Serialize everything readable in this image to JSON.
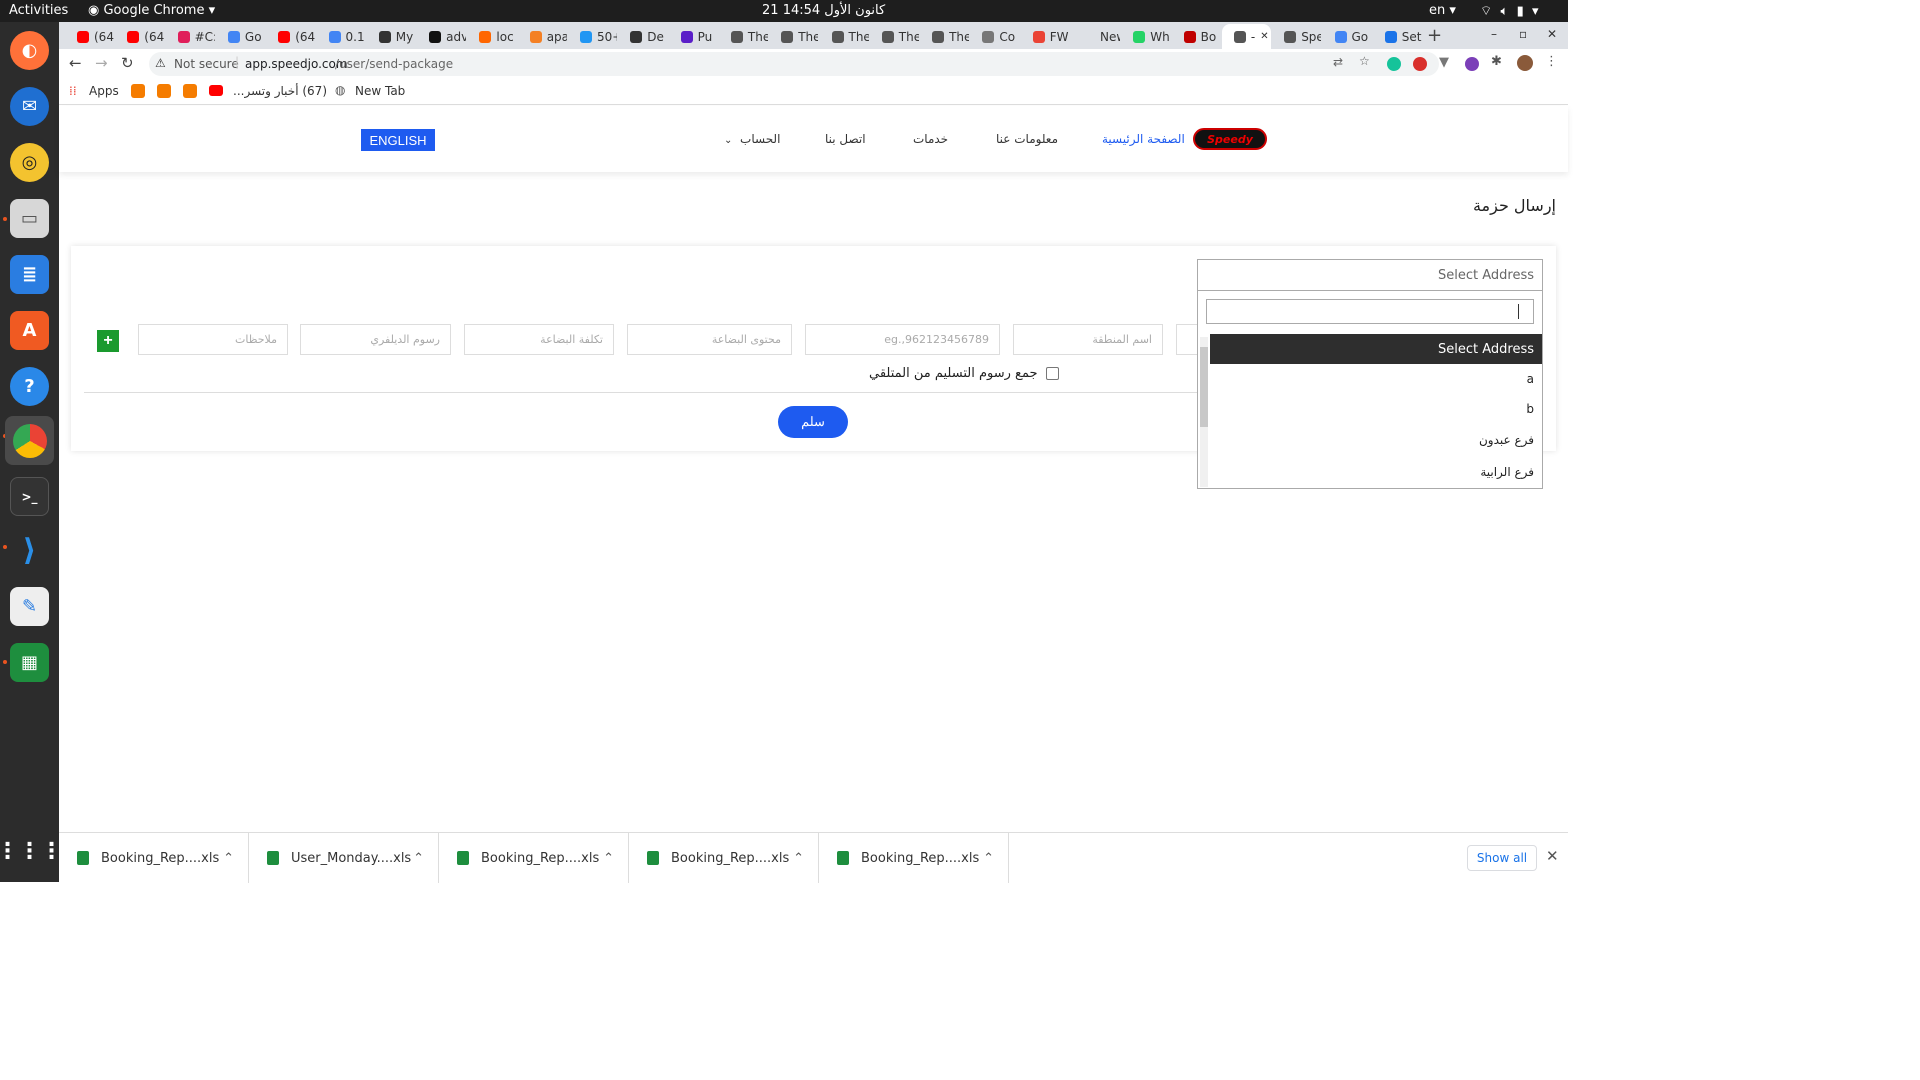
{
  "system_bar": {
    "activities": "Activities",
    "app_name": "Google Chrome",
    "datetime": "21 كانون الأول 14:54",
    "lang": "en"
  },
  "dock": {
    "apps": [
      "firefox-icon",
      "thunderbird-icon",
      "rhythmbox-icon",
      "files-icon",
      "writer-icon",
      "software-icon",
      "help-icon",
      "chrome-icon",
      "terminal-icon",
      "vscode-icon",
      "text-editor-icon",
      "calc-icon"
    ],
    "grid": "show-apps-icon"
  },
  "tabs": [
    {
      "label": "(64",
      "color": "#ff0000"
    },
    {
      "label": "(64",
      "color": "#ff0000"
    },
    {
      "label": "#C:",
      "color": "#e01e5a"
    },
    {
      "label": "Go",
      "color": "#4285f4"
    },
    {
      "label": "(64",
      "color": "#ff0000"
    },
    {
      "label": "0.1",
      "color": "#4285f4"
    },
    {
      "label": "My",
      "color": "#333333"
    },
    {
      "label": "adv",
      "color": "#111111"
    },
    {
      "label": "loc",
      "color": "#ff6600"
    },
    {
      "label": "apa",
      "color": "#f48024"
    },
    {
      "label": "50+",
      "color": "#2196f3"
    },
    {
      "label": "De",
      "color": "#333333"
    },
    {
      "label": "Pu",
      "color": "#5a1ec8"
    },
    {
      "label": "The",
      "color": "#555555"
    },
    {
      "label": "The",
      "color": "#555555"
    },
    {
      "label": "The",
      "color": "#555555"
    },
    {
      "label": "The",
      "color": "#555555"
    },
    {
      "label": "The",
      "color": "#555555"
    },
    {
      "label": "Co",
      "color": "#777777"
    },
    {
      "label": "FW",
      "color": "#ea4335"
    },
    {
      "label": "New Ta",
      "color": "#dee1e6"
    },
    {
      "label": "Wh",
      "color": "#25d366"
    },
    {
      "label": "Bo",
      "color": "#c00000"
    },
    {
      "label": "-",
      "color": "#555555",
      "active": true
    },
    {
      "label": "Spe",
      "color": "#555555"
    },
    {
      "label": "Go",
      "color": "#4285f4"
    },
    {
      "label": "Set",
      "color": "#1a73e8"
    }
  ],
  "address_bar": {
    "security": "Not secure",
    "url_domain": "app.speedjo.com",
    "url_path": "/user/send-package"
  },
  "bookmarks": {
    "apps": "Apps",
    "items": [
      "(67) أخبار وتسر...",
      "New Tab"
    ]
  },
  "site_nav": {
    "logo_text": "Speedy",
    "home": "الصفحة الرئيسية",
    "about": "معلومات عنا",
    "services": "خدمات",
    "contact": "اتصل بنا",
    "account": "الحساب",
    "language_button": "ENGLISH"
  },
  "page": {
    "title": "إرسال حزمة",
    "fields": {
      "area_placeholder": "اسم المنطقة",
      "phone_placeholder": "eg.,962123456789",
      "content_placeholder": "محتوى البضاعة",
      "cost_placeholder": "تكلفة البضاعة",
      "delivery_fee_placeholder": "رسوم الديلفري",
      "notes_placeholder": "ملاحظات"
    },
    "add_button": "+",
    "collect_fee_label": "جمع رسوم التسليم من المتلقي",
    "submit": "سلم"
  },
  "address_select": {
    "selected": "Select Address",
    "search_value": "",
    "options": [
      "Select Address",
      "a",
      "b",
      "فرع عبدون",
      "فرع الرابية"
    ]
  },
  "downloads": {
    "items": [
      "Booking_Rep....xls",
      "User_Monday....xls",
      "Booking_Rep....xls",
      "Booking_Rep....xls",
      "Booking_Rep....xls"
    ],
    "show_all": "Show all"
  }
}
